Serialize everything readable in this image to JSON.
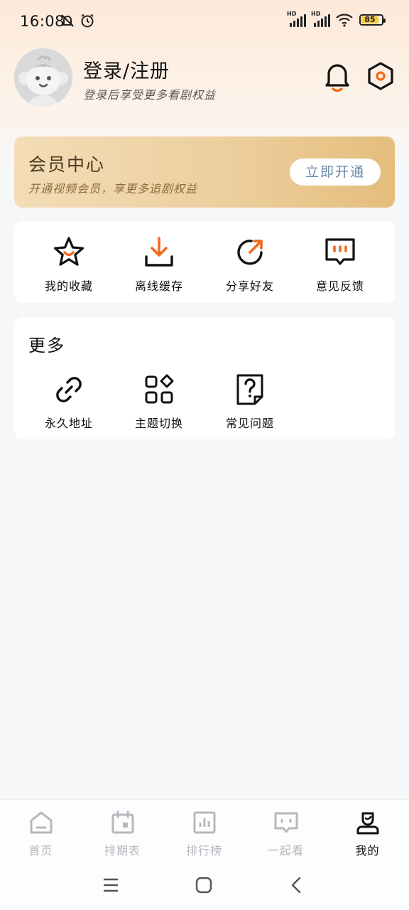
{
  "status_bar": {
    "time": "16:08",
    "battery": "85",
    "hd1": "HD",
    "hd2": "HD"
  },
  "profile": {
    "title": "登录/注册",
    "subtitle": "登录后享受更多看剧权益"
  },
  "vip": {
    "title": "会员中心",
    "subtitle": "开通视频会员，享更多追剧权益",
    "button": "立即开通"
  },
  "quick_actions": [
    {
      "label": "我的收藏",
      "icon": "star-icon"
    },
    {
      "label": "离线缓存",
      "icon": "download-icon"
    },
    {
      "label": "分享好友",
      "icon": "share-icon"
    },
    {
      "label": "意见反馈",
      "icon": "feedback-icon"
    }
  ],
  "more": {
    "title": "更多",
    "items": [
      {
        "label": "永久地址",
        "icon": "link-icon"
      },
      {
        "label": "主题切换",
        "icon": "theme-icon"
      },
      {
        "label": "常见问题",
        "icon": "faq-icon"
      }
    ]
  },
  "tabs": [
    {
      "label": "首页",
      "icon": "home-icon"
    },
    {
      "label": "排期表",
      "icon": "calendar-icon"
    },
    {
      "label": "排行榜",
      "icon": "ranking-icon"
    },
    {
      "label": "一起看",
      "icon": "watch-together-icon"
    },
    {
      "label": "我的",
      "icon": "profile-icon",
      "active": true
    }
  ],
  "colors": {
    "accent": "#f06a1c",
    "vip_gold": "#e4bd7c",
    "inactive_tab": "#b5b8bf"
  }
}
